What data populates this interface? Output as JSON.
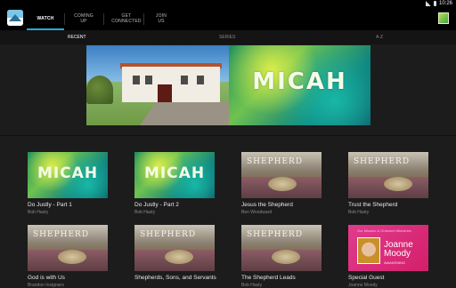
{
  "status": {
    "time": "10:26"
  },
  "nav": {
    "tabs": [
      {
        "line1": "WATCH",
        "line2": ""
      },
      {
        "line1": "COMING",
        "line2": "UP"
      },
      {
        "line1": "GET",
        "line2": "CONNECTED"
      },
      {
        "line1": "JOIN",
        "line2": "US"
      }
    ]
  },
  "subtabs": [
    "RECENT",
    "SERIES",
    "A-Z"
  ],
  "hero": {
    "art_text": "MICAH"
  },
  "videos": [
    {
      "title": "Do Justly - Part 1",
      "speaker": "Bob Hasty",
      "art": "micah",
      "art_text": "MICAH"
    },
    {
      "title": "Do Justly - Part 2",
      "speaker": "Bob Hasty",
      "art": "micah",
      "art_text": "MICAH"
    },
    {
      "title": "Jesus the Shepherd",
      "speaker": "Ben Woodward",
      "art": "shepherd",
      "art_text": "SHEPHERD"
    },
    {
      "title": "Trust the Shepherd",
      "speaker": "Bob Hasty",
      "art": "shepherd",
      "art_text": "SHEPHERD"
    },
    {
      "title": "God is with Us",
      "speaker": "Brandon Insignaro",
      "art": "shepherd",
      "art_text": "SHEPHERD"
    },
    {
      "title": "Shepherds, Sons, and Servants",
      "speaker": "",
      "art": "shepherd",
      "art_text": "SHEPHERD"
    },
    {
      "title": "The Shepherd Leads",
      "speaker": "Bob Hasty",
      "art": "shepherd",
      "art_text": "SHEPHERD"
    },
    {
      "title": "Special Guest",
      "speaker": "Joanne Moody",
      "art": "guest",
      "art_text": "Joanne Moody",
      "art_top": "Our Mission & Outreach Ministries",
      "art_small": "AWAKENING"
    }
  ]
}
